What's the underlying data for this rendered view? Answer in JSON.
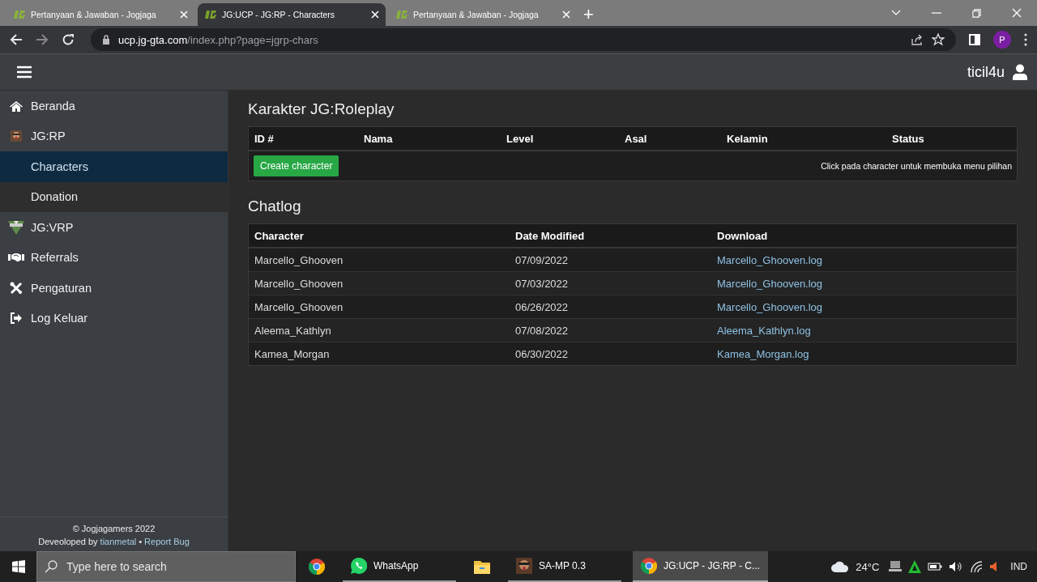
{
  "browser": {
    "tabs": [
      {
        "title": "Pertanyaan & Jawaban - Jogjaga",
        "selected": false
      },
      {
        "title": "JG:UCP - JG:RP - Characters",
        "selected": true
      },
      {
        "title": "Pertanyaan & Jawaban - Jogjaga",
        "selected": false
      }
    ],
    "new_tab": "+",
    "url_host": "ucp.jg-gta.com",
    "url_path": "/index.php?page=jgrp-chars",
    "profile": "P"
  },
  "topbar": {
    "username": "ticil4u"
  },
  "sidebar": {
    "items": [
      {
        "label": "Beranda",
        "kind": "main",
        "selected": false
      },
      {
        "label": "JG:RP",
        "kind": "main",
        "selected": false
      },
      {
        "label": "Characters",
        "kind": "sub",
        "selected": true
      },
      {
        "label": "Donation",
        "kind": "sub",
        "selected": false
      },
      {
        "label": "JG:VRP",
        "kind": "main",
        "selected": false
      },
      {
        "label": "Referrals",
        "kind": "main",
        "selected": false
      },
      {
        "label": "Pengaturan",
        "kind": "main",
        "selected": false
      },
      {
        "label": "Log Keluar",
        "kind": "main",
        "selected": false
      }
    ],
    "footer": {
      "copyright": "© Jogjagamers 2022",
      "developed_by": "Deveoloped by",
      "author_link": "tianmetal",
      "separator": "•",
      "report_link": "Report Bug"
    }
  },
  "characters": {
    "title": "Karakter JG:Roleplay",
    "columns": [
      "ID #",
      "Nama",
      "Level",
      "Asal",
      "Kelamin",
      "Status"
    ],
    "create_button": "Create character",
    "hint": "Click pada character untuk membuka menu pilihan"
  },
  "chatlog": {
    "title": "Chatlog",
    "columns": [
      "Character",
      "Date Modified",
      "Download"
    ],
    "rows": [
      {
        "character": "Marcello_Ghooven",
        "date": "07/09/2022",
        "file": "Marcello_Ghooven.log"
      },
      {
        "character": "Marcello_Ghooven",
        "date": "07/03/2022",
        "file": "Marcello_Ghooven.log"
      },
      {
        "character": "Marcello_Ghooven",
        "date": "06/26/2022",
        "file": "Marcello_Ghooven.log"
      },
      {
        "character": "Aleema_Kathlyn",
        "date": "07/08/2022",
        "file": "Aleema_Kathlyn.log"
      },
      {
        "character": "Kamea_Morgan",
        "date": "06/30/2022",
        "file": "Kamea_Morgan.log"
      }
    ]
  },
  "taskbar": {
    "search_placeholder": "Type here to search",
    "apps": [
      {
        "kind": "chrome",
        "open": false,
        "selected": false
      },
      {
        "kind": "whatsapp",
        "label": "WhatsApp",
        "open": true,
        "selected": false
      },
      {
        "kind": "folder",
        "open": false,
        "selected": false
      },
      {
        "kind": "game",
        "label": "SA-MP 0.3",
        "open": true,
        "selected": false
      },
      {
        "kind": "chrome",
        "label": "JG:UCP - JG:RP - C...",
        "open": true,
        "selected": true
      }
    ],
    "temperature": "24°C",
    "language": "IND"
  }
}
